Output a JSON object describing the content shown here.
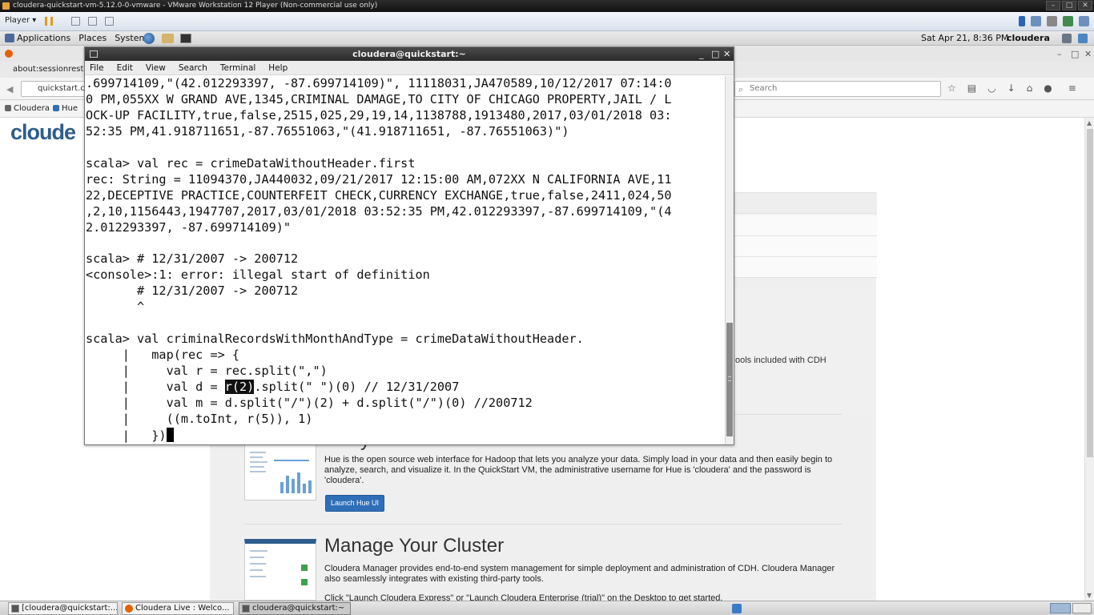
{
  "vmware": {
    "title": "cloudera-quickstart-vm-5.12.0-0-vmware - VMware Workstation 12 Player (Non-commercial use only)",
    "player_menu": "Player ▾"
  },
  "gnome": {
    "applications": "Applications",
    "places": "Places",
    "system": "System",
    "clock": "Sat Apr 21,  8:36 PM",
    "user": "cloudera"
  },
  "firefox": {
    "tab_label": "about:sessionresto",
    "url": "quickstart.cl",
    "search_placeholder": "Search",
    "bookmarks": [
      "Cloudera",
      "Hue"
    ],
    "logo_text": "cloude",
    "tools_text": "ools included with CDH",
    "hue_section": {
      "title_fragment": "y",
      "body": "Hue is the open source web interface for Hadoop that lets you analyze your data. Simply load in your data and then easily begin to analyze, search, and visualize it. In the QuickStart VM, the administrative username for Hue is 'cloudera' and the password is 'cloudera'.",
      "button": "Launch Hue UI"
    },
    "cluster_section": {
      "title": "Manage Your Cluster",
      "body": "Cloudera Manager provides end-to-end system management for simple deployment and administration of CDH. Cloudera Manager also seamlessly integrates with existing third-party tools.",
      "body2": "Click \"Launch Cloudera Express\" or \"Launch Cloudera Enterprise (trial)\" on the Desktop to get started."
    }
  },
  "terminal": {
    "title": "cloudera@quickstart:~",
    "menu": [
      "File",
      "Edit",
      "View",
      "Search",
      "Terminal",
      "Help"
    ],
    "lines": [
      ".699714109,\"(42.012293397, -87.699714109)\", 11118031,JA470589,10/12/2017 07:14:0",
      "0 PM,055XX W GRAND AVE,1345,CRIMINAL DAMAGE,TO CITY OF CHICAGO PROPERTY,JAIL / L",
      "OCK-UP FACILITY,true,false,2515,025,29,19,14,1138788,1913480,2017,03/01/2018 03:",
      "52:35 PM,41.918711651,-87.76551063,\"(41.918711651, -87.76551063)\")",
      "",
      "scala> val rec = crimeDataWithoutHeader.first",
      "rec: String = 11094370,JA440032,09/21/2017 12:15:00 AM,072XX N CALIFORNIA AVE,11",
      "22,DECEPTIVE PRACTICE,COUNTERFEIT CHECK,CURRENCY EXCHANGE,true,false,2411,024,50",
      ",2,10,1156443,1947707,2017,03/01/2018 03:52:35 PM,42.012293397,-87.699714109,\"(4",
      "2.012293397, -87.699714109)\"",
      "",
      "scala> # 12/31/2007 -> 200712",
      "<console>:1: error: illegal start of definition",
      "       # 12/31/2007 -> 200712",
      "       ^",
      "",
      "scala> val criminalRecordsWithMonthAndType = crimeDataWithoutHeader.",
      "     |   map(rec => {",
      "     |     val r = rec.split(\",\")",
      "     |     val d = ",
      "     |     val m = d.split(\"/\")(2) + d.split(\"/\")(0) //200712",
      "     |     ((m.toInt, r(5)), 1)",
      "     |   })"
    ],
    "highlighted_line": {
      "prefix": "     |     val d = ",
      "selection": "r(2)",
      "suffix": ".split(\" \")(0) // 12/31/2007"
    }
  },
  "taskbar": {
    "items": [
      "[cloudera@quickstart:...",
      "Cloudera Live : Welco...",
      "cloudera@quickstart:~"
    ]
  },
  "colors": {
    "terminal_titlebar": "#3a3a3a",
    "hue_button": "#2f6fb8",
    "cloudera_blue": "#2d5d8c"
  }
}
